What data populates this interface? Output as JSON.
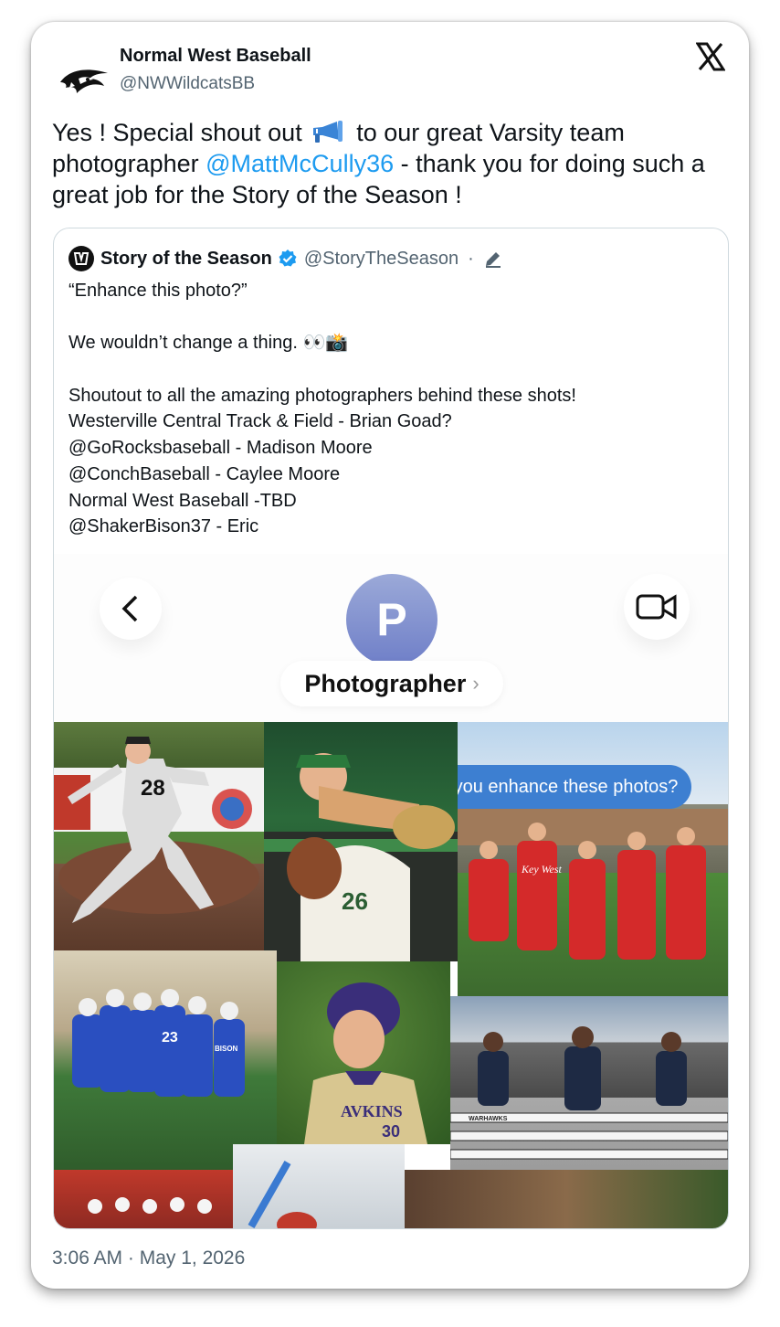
{
  "author": {
    "name": "Normal West Baseball",
    "handle": "@NWWildcatsBB",
    "avatar_icon": "wildcat-logo-icon"
  },
  "tweet": {
    "text_before": "Yes ! Special shout out",
    "text_after_icon": " to our great Varsity team photographer ",
    "mention": "@MattMcCully36",
    "text_end": "  - thank you for doing such a great job for the Story of the Season !",
    "icon": "megaphone-icon",
    "mention_color": "#1d9bf0"
  },
  "quote": {
    "name": "Story of the Season",
    "handle": "@StoryTheSeason",
    "separator": "·",
    "verified_color": "#1d9bf0",
    "lines": [
      "“Enhance this photo?”",
      "",
      "We wouldn’t change a thing. 👀📸",
      "",
      "Shoutout to all the amazing photographers behind these shots!",
      "Westerville Central Track & Field - Brian Goad?",
      "@GoRocksbaseball - Madison Moore",
      "@ConchBaseball - Caylee Moore",
      "Normal West Baseball -TBD",
      "@ShakerBison37 - Eric"
    ]
  },
  "media": {
    "contact_initial": "P",
    "contact_name": "Photographer",
    "contact_chevron": "›",
    "message_bubble": "Hey, can you enhance these photos?",
    "bubble_color": "#3d7fd1",
    "photo_jerseys": {
      "pitcher": "28",
      "dugout": "26",
      "lacrosse": "23",
      "lacrosse_team": "BISON",
      "batter_number": "30",
      "batter_team": "AVKINS",
      "hurdles": "WARHAWKS",
      "red_team": "Key West"
    }
  },
  "timestamp": "3:06 AM · May 1, 2026"
}
